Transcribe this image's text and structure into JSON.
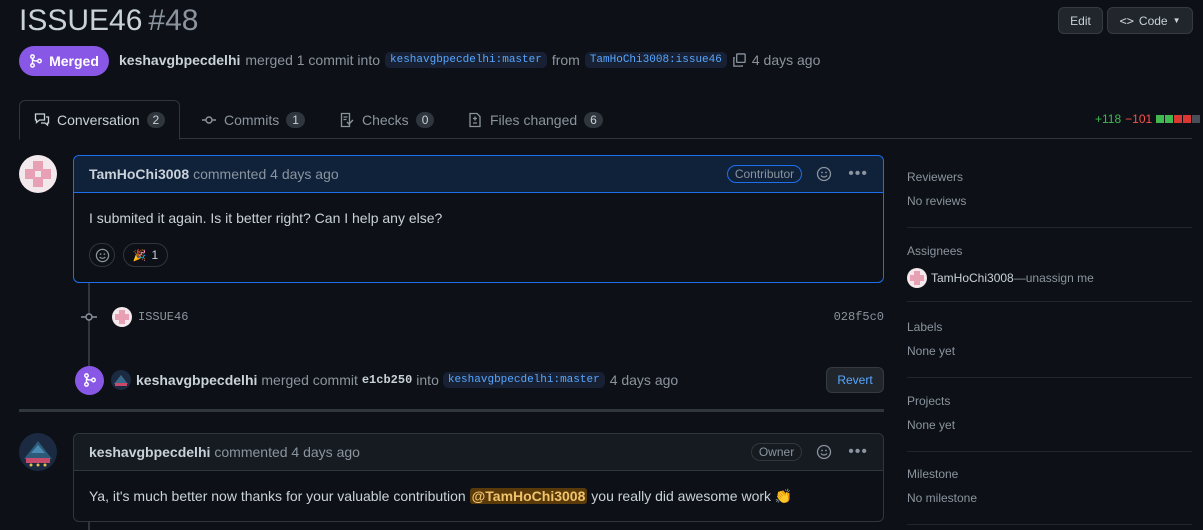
{
  "header": {
    "title": "ISSUE46",
    "number": "#48",
    "edit_label": "Edit",
    "code_label": "Code"
  },
  "status": {
    "badge": "Merged",
    "author": "keshavgbpecdelhi",
    "action": "merged 1 commit into",
    "base_branch": "keshavgbpecdelhi:master",
    "from": "from",
    "head_branch": "TamHoChi3008:issue46",
    "time": "4 days ago"
  },
  "tabs": [
    {
      "label": "Conversation",
      "count": "2",
      "icon": "comment-discussion-icon"
    },
    {
      "label": "Commits",
      "count": "1",
      "icon": "git-commit-icon"
    },
    {
      "label": "Checks",
      "count": "0",
      "icon": "checklist-icon"
    },
    {
      "label": "Files changed",
      "count": "6",
      "icon": "file-diff-icon"
    }
  ],
  "diffstat": {
    "additions": "+118",
    "deletions": "−101"
  },
  "comments": [
    {
      "author": "TamHoChi3008",
      "meta": "commented 4 days ago",
      "role": "Contributor",
      "body": "I submited it again. Is it better right? Can I help any else?",
      "reaction_emoji": "🎉",
      "reaction_count": "1"
    },
    {
      "author": "keshavgbpecdelhi",
      "meta": "commented 4 days ago",
      "role": "Owner",
      "body_before": "Ya, it's much better now thanks for your valuable contribution",
      "mention": "@TamHoChi3008",
      "body_after": "you really did awesome work 👏"
    }
  ],
  "commit": {
    "message": "ISSUE46",
    "sha": "028f5c0"
  },
  "merge_event": {
    "author": "keshavgbpecdelhi",
    "action": "merged commit",
    "sha": "e1cb250",
    "into": "into",
    "branch": "keshavgbpecdelhi:master",
    "time": "4 days ago",
    "revert_label": "Revert"
  },
  "sidebar": [
    {
      "title": "Reviewers",
      "value": "No reviews"
    },
    {
      "title": "Assignees",
      "value": "TamHoChi3008",
      "suffix": "—unassign me"
    },
    {
      "title": "Labels",
      "value": "None yet"
    },
    {
      "title": "Projects",
      "value": "None yet"
    },
    {
      "title": "Milestone",
      "value": "No milestone"
    }
  ],
  "colors": {
    "merged": "#8957e5",
    "accent": "#58a6ff",
    "add": "#3fb950",
    "del": "#f85149"
  }
}
